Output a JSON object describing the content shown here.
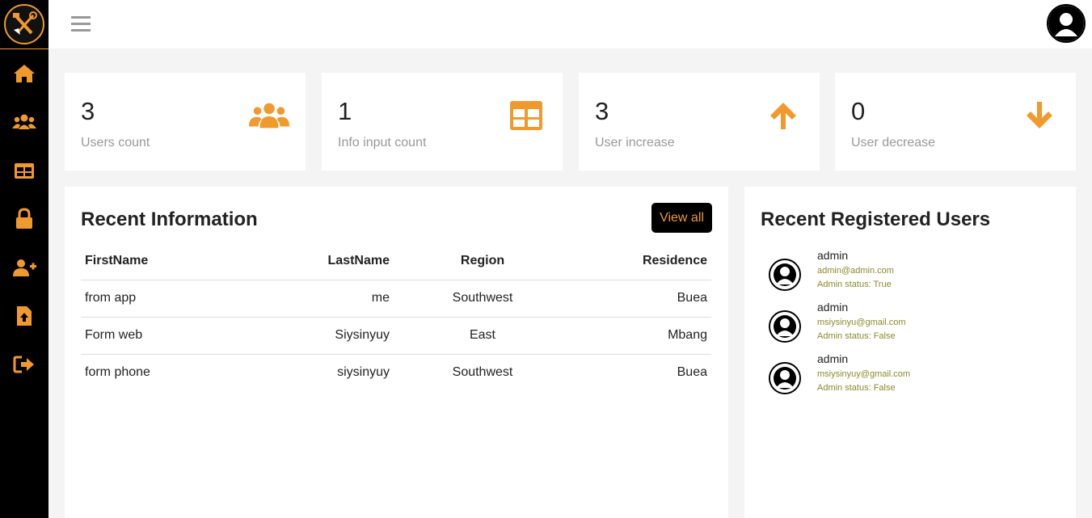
{
  "colors": {
    "accent": "#f09a2e",
    "sidebar": "#000000",
    "muted_text": "#999999",
    "user_meta": "#8a8a2e"
  },
  "sidebar": {
    "items": [
      {
        "icon": "home-icon"
      },
      {
        "icon": "users-icon"
      },
      {
        "icon": "table-icon"
      },
      {
        "icon": "lock-icon"
      },
      {
        "icon": "user-plus-icon"
      },
      {
        "icon": "file-upload-icon"
      },
      {
        "icon": "sign-out-icon"
      }
    ]
  },
  "stats": [
    {
      "value": "3",
      "label": "Users count",
      "icon": "users-icon"
    },
    {
      "value": "1",
      "label": "Info input count",
      "icon": "table-icon"
    },
    {
      "value": "3",
      "label": "User increase",
      "icon": "arrow-up-icon"
    },
    {
      "value": "0",
      "label": "User decrease",
      "icon": "arrow-down-icon"
    }
  ],
  "recent_info": {
    "title": "Recent Information",
    "view_all": "View all",
    "columns": [
      "FirstName",
      "LastName",
      "Region",
      "Residence"
    ],
    "rows": [
      [
        "from app",
        "me",
        "Southwest",
        "Buea"
      ],
      [
        "Form web",
        "Siysinyuy",
        "East",
        "Mbang"
      ],
      [
        "form phone",
        "siysinyuy",
        "Southwest",
        "Buea"
      ]
    ]
  },
  "recent_users": {
    "title": "Recent Registered Users",
    "users": [
      {
        "name": "admin",
        "email": "admin@admin.com",
        "status": "Admin status: True"
      },
      {
        "name": "admin",
        "email": "msiysinyu@gmail.com",
        "status": "Admin status: False"
      },
      {
        "name": "admin",
        "email": "msiysinyuy@gmail.com",
        "status": "Admin status: False"
      }
    ]
  }
}
